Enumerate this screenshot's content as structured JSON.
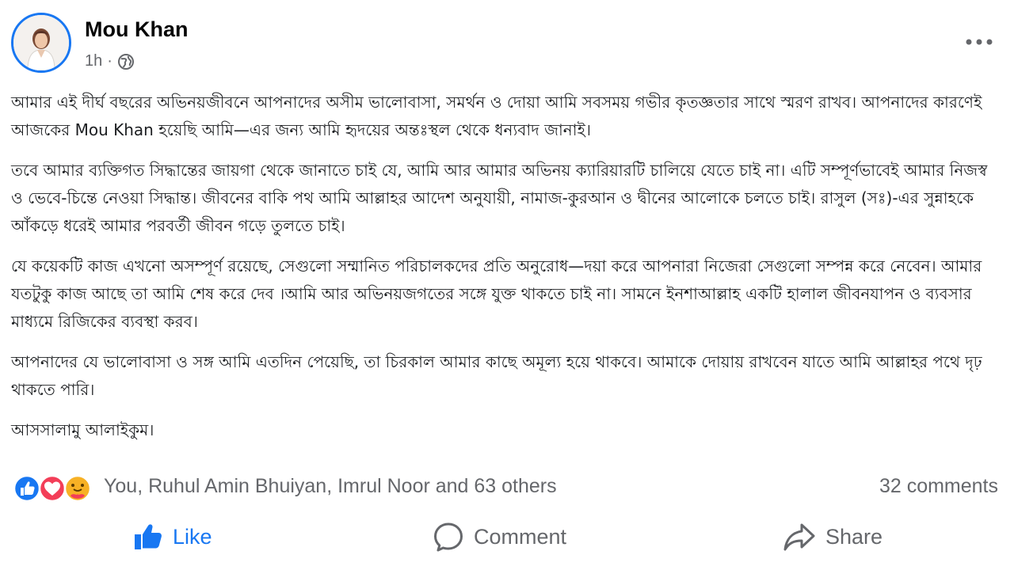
{
  "post": {
    "author": "Mou Khan",
    "time": "1h",
    "separator": "·",
    "privacy_icon": "globe-icon",
    "more_icon": "more-dots-icon"
  },
  "body": {
    "paragraphs": [
      "আমার এই দীর্ঘ বছরের অভিনয়জীবনে আপনাদের অসীম ভালোবাসা, সমর্থন ও দোয়া আমি সবসময় গভীর কৃতজ্ঞতার সাথে স্মরণ রাখব। আপনাদের কারণেই আজকের Mou Khan হয়েছি আমি—এর জন্য আমি হৃদয়ের অন্তঃস্থল থেকে ধন্যবাদ জানাই।",
      "তবে আমার ব্যক্তিগত সিদ্ধান্তের জায়গা থেকে জানাতে চাই যে, আমি আর আমার অভিনয় ক্যারিয়ারটি চালিয়ে যেতে চাই না। এটি সম্পূর্ণভাবেই আমার নিজস্ব ও ভেবে-চিন্তে নেওয়া সিদ্ধান্ত। জীবনের বাকি পথ আমি আল্লাহর আদেশ অনুযায়ী, নামাজ-কুরআন ও দ্বীনের আলোকে চলতে চাই। রাসুল (সঃ)-এর সুন্নাহকে আঁকড়ে ধরেই আমার পরবর্তী জীবন গড়ে তুলতে চাই।",
      "যে কয়েকটি কাজ এখনো অসম্পূর্ণ রয়েছে, সেগুলো সম্মানিত পরিচালকদের প্রতি অনুরোধ—দয়া করে আপনারা নিজেরা সেগুলো সম্পন্ন করে নেবেন। আমার যতটুকু কাজ আছে তা আমি শেষ করে দেব ।আমি আর অভিনয়জগতের সঙ্গে যুক্ত থাকতে চাই না। সামনে ইনশাআল্লাহ একটি হালাল জীবনযাপন ও ব্যবসার মাধ্যমে রিজিকের ব্যবস্থা করব।",
      "আপনাদের যে ভালোবাসা ও সঙ্গ আমি এতদিন পেয়েছি, তা চিরকাল আমার কাছে অমূল্য হয়ে থাকবে। আমাকে দোয়ায় রাখবেন যাতে আমি আল্লাহর পথে দৃঢ় থাকতে পারি।",
      "আসসালামু আলাইকুম।"
    ]
  },
  "reactions": {
    "icons": [
      "like-reaction-icon",
      "love-reaction-icon",
      "care-reaction-icon"
    ],
    "names": "You, Ruhul Amin Bhuiyan, Imrul Noor and 63 others",
    "comments": "32 comments"
  },
  "actions": {
    "like": "Like",
    "comment": "Comment",
    "share": "Share"
  },
  "colors": {
    "accent": "#1877f2",
    "secondary_text": "#65676b",
    "love": "#f33e58",
    "care": "#f7b125"
  }
}
